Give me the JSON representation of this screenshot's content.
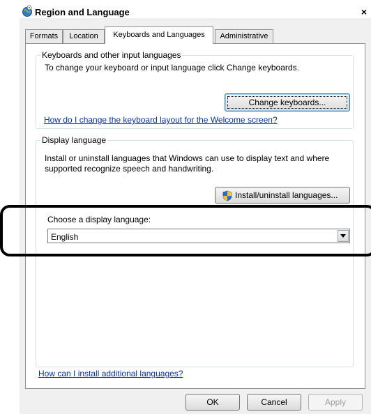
{
  "window": {
    "title": "Region and Language",
    "close_glyph": "×"
  },
  "tabs": [
    {
      "label": "Formats"
    },
    {
      "label": "Location"
    },
    {
      "label": "Keyboards and Languages"
    },
    {
      "label": "Administrative"
    }
  ],
  "keyboards_group": {
    "title": "Keyboards and other input languages",
    "description": "To change your keyboard or input language click Change keyboards.",
    "change_button": "Change keyboards...",
    "help_link": "How do I change the keyboard layout for the Welcome screen?"
  },
  "display_group": {
    "title": "Display language",
    "description": "Install or uninstall languages that Windows can use to display text and where supported recognize speech and handwriting.",
    "install_button": "Install/uninstall languages...",
    "choose_label": "Choose a display language:",
    "selected_language": "English"
  },
  "install_link": "How can I install additional languages?",
  "footer": {
    "ok": "OK",
    "cancel": "Cancel",
    "apply": "Apply"
  },
  "icons": {
    "title": "globe-icon",
    "shield": "shield-icon",
    "dropdown": "chevron-down-icon"
  }
}
